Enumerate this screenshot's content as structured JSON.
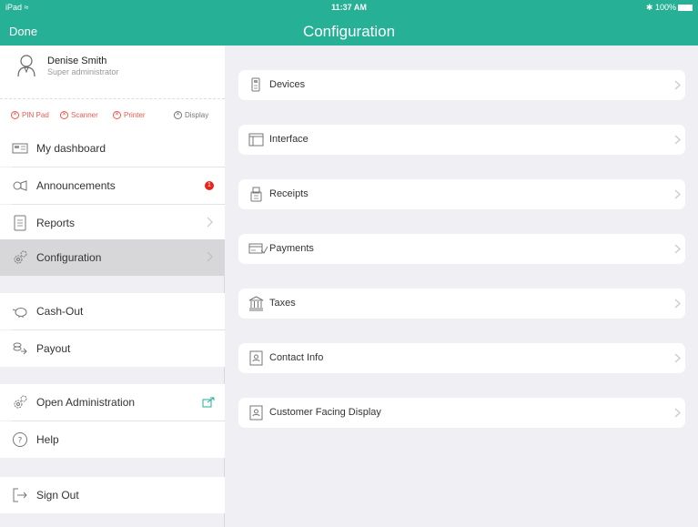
{
  "status": {
    "device": "iPad",
    "time": "11:37 AM",
    "battery": "100%"
  },
  "header": {
    "done": "Done",
    "title": "Configuration"
  },
  "user": {
    "name": "Denise Smith",
    "role": "Super administrator"
  },
  "device_status": [
    {
      "label": "PIN Pad",
      "state": "error"
    },
    {
      "label": "Scanner",
      "state": "error"
    },
    {
      "label": "Printer",
      "state": "error"
    },
    {
      "label": "Display",
      "state": "ok"
    }
  ],
  "sidebar": {
    "dashboard": "My dashboard",
    "announcements": "Announcements",
    "announcements_badge": "1",
    "reports": "Reports",
    "configuration": "Configuration",
    "cashout": "Cash-Out",
    "payout": "Payout",
    "open_admin": "Open Administration",
    "help": "Help",
    "signout": "Sign Out"
  },
  "config_items": [
    {
      "label": "Devices",
      "icon": "device-icon"
    },
    {
      "label": "Interface",
      "icon": "interface-icon"
    },
    {
      "label": "Receipts",
      "icon": "receipt-icon"
    },
    {
      "label": "Payments",
      "icon": "payment-icon"
    },
    {
      "label": "Taxes",
      "icon": "taxes-icon"
    },
    {
      "label": "Contact Info",
      "icon": "contact-icon"
    },
    {
      "label": "Customer Facing Display",
      "icon": "display-icon"
    }
  ],
  "colors": {
    "accent": "#26b096",
    "error": "#f05a4f",
    "badge": "#e8231b",
    "active_row": "#d7d7d9"
  }
}
